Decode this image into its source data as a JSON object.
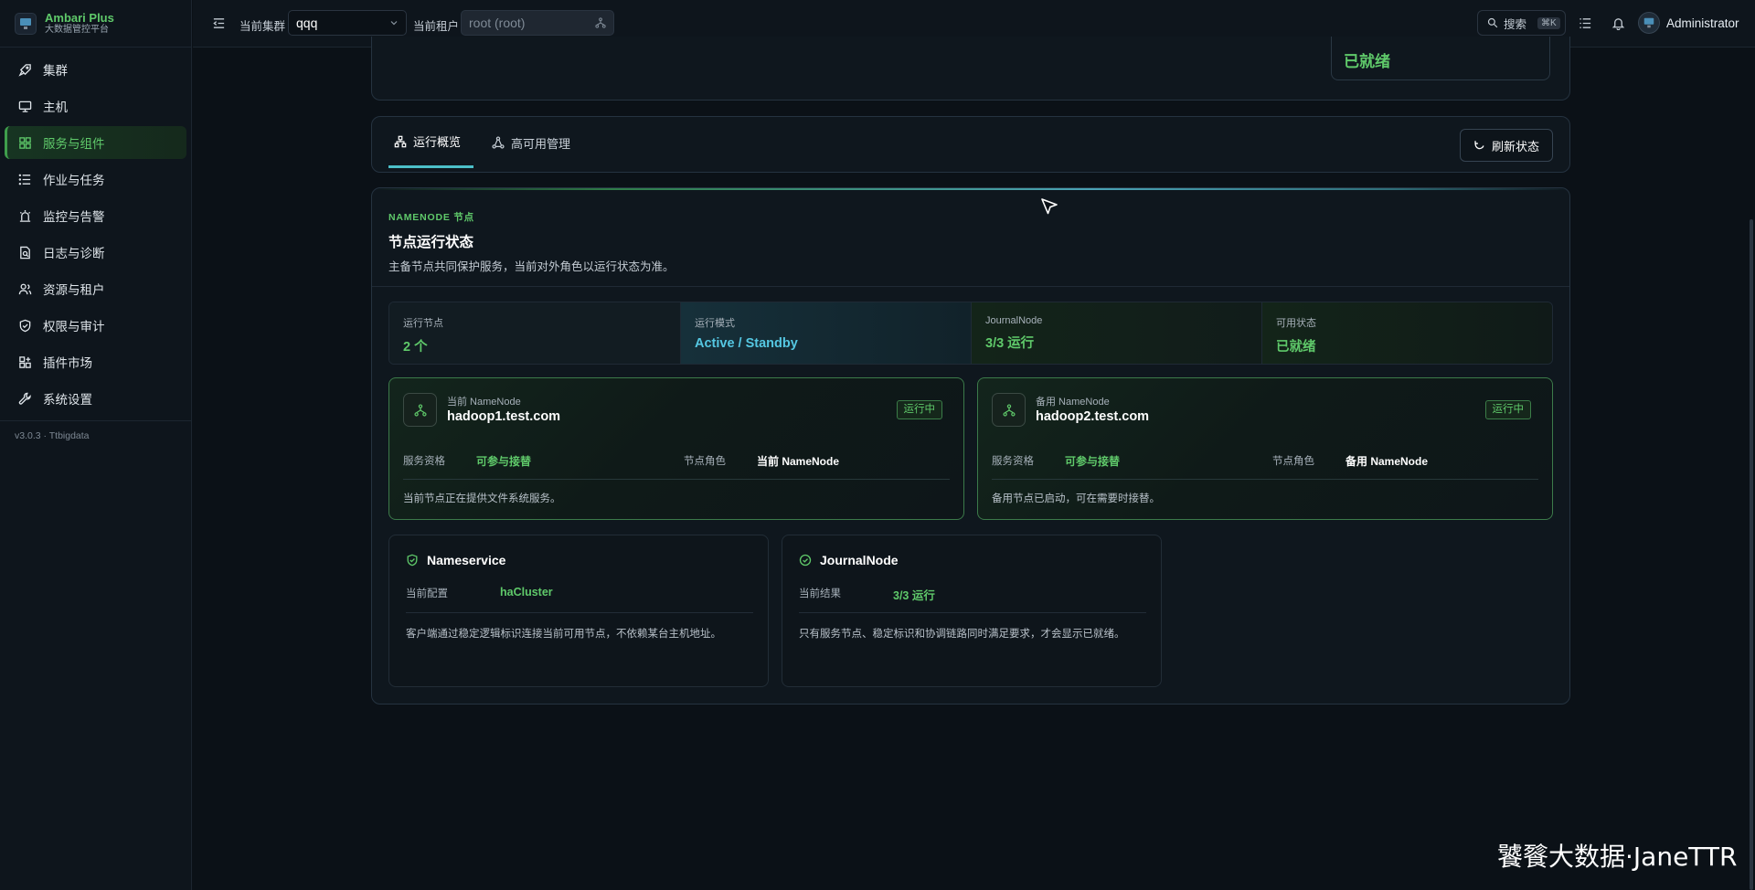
{
  "brand": {
    "title": "Ambari Plus",
    "subtitle": "大数据管控平台"
  },
  "sidebar": {
    "items": [
      {
        "label": "集群",
        "icon": "rocket-icon"
      },
      {
        "label": "主机",
        "icon": "monitor-icon"
      },
      {
        "label": "服务与组件",
        "icon": "grid-icon",
        "active": true
      },
      {
        "label": "作业与任务",
        "icon": "list-icon"
      },
      {
        "label": "监控与告警",
        "icon": "alarm-icon"
      },
      {
        "label": "日志与诊断",
        "icon": "log-icon"
      },
      {
        "label": "资源与租户",
        "icon": "users-icon"
      },
      {
        "label": "权限与审计",
        "icon": "shield-icon"
      },
      {
        "label": "插件市场",
        "icon": "plugin-icon"
      },
      {
        "label": "系统设置",
        "icon": "wrench-icon"
      }
    ],
    "version": "v3.0.3 · Ttbigdata"
  },
  "header": {
    "cluster_label": "当前集群",
    "cluster_value": "qqq",
    "tenant_label": "当前租户",
    "tenant_placeholder": "root (root)",
    "search_label": "搜索",
    "search_shortcut": "⌘K",
    "user_name": "Administrator"
  },
  "top_panel": {
    "status": "已就绪"
  },
  "tabs": {
    "items": [
      {
        "label": "运行概览",
        "active": true
      },
      {
        "label": "高可用管理",
        "active": false
      }
    ],
    "refresh_label": "刷新状态"
  },
  "section": {
    "eyebrow": "NAMENODE 节点",
    "title": "节点运行状态",
    "description": "主备节点共同保护服务，当前对外角色以运行状态为准。"
  },
  "stats": [
    {
      "label": "运行节点",
      "value": "2 个"
    },
    {
      "label": "运行模式",
      "value": "Active / Standby"
    },
    {
      "label": "JournalNode",
      "value": "3/3 运行"
    },
    {
      "label": "可用状态",
      "value": "已就绪"
    }
  ],
  "nodes": [
    {
      "role_label": "当前 NameNode",
      "host": "hadoop1.test.com",
      "badge": "运行中",
      "qual_label": "服务资格",
      "qual_value": "可参与接替",
      "role_key": "节点角色",
      "role_value": "当前 NameNode",
      "note": "当前节点正在提供文件系统服务。"
    },
    {
      "role_label": "备用 NameNode",
      "host": "hadoop2.test.com",
      "badge": "运行中",
      "qual_label": "服务资格",
      "qual_value": "可参与接替",
      "role_key": "节点角色",
      "role_value": "备用 NameNode",
      "note": "备用节点已启动，可在需要时接替。"
    }
  ],
  "info_cards": [
    {
      "title": "Nameservice",
      "key": "当前配置",
      "value": "haCluster",
      "note": "客户端通过稳定逻辑标识连接当前可用节点，不依赖某台主机地址。"
    },
    {
      "title": "JournalNode",
      "key": "当前结果",
      "value": "3/3 运行",
      "note": "只有服务节点、稳定标识和协调链路同时满足要求，才会显示已就绪。"
    }
  ],
  "watermark": "饕餮大数据·JaneTTR",
  "colors": {
    "accent": "#5fc96a",
    "cyan": "#55c7e2",
    "background": "#0b1117"
  }
}
